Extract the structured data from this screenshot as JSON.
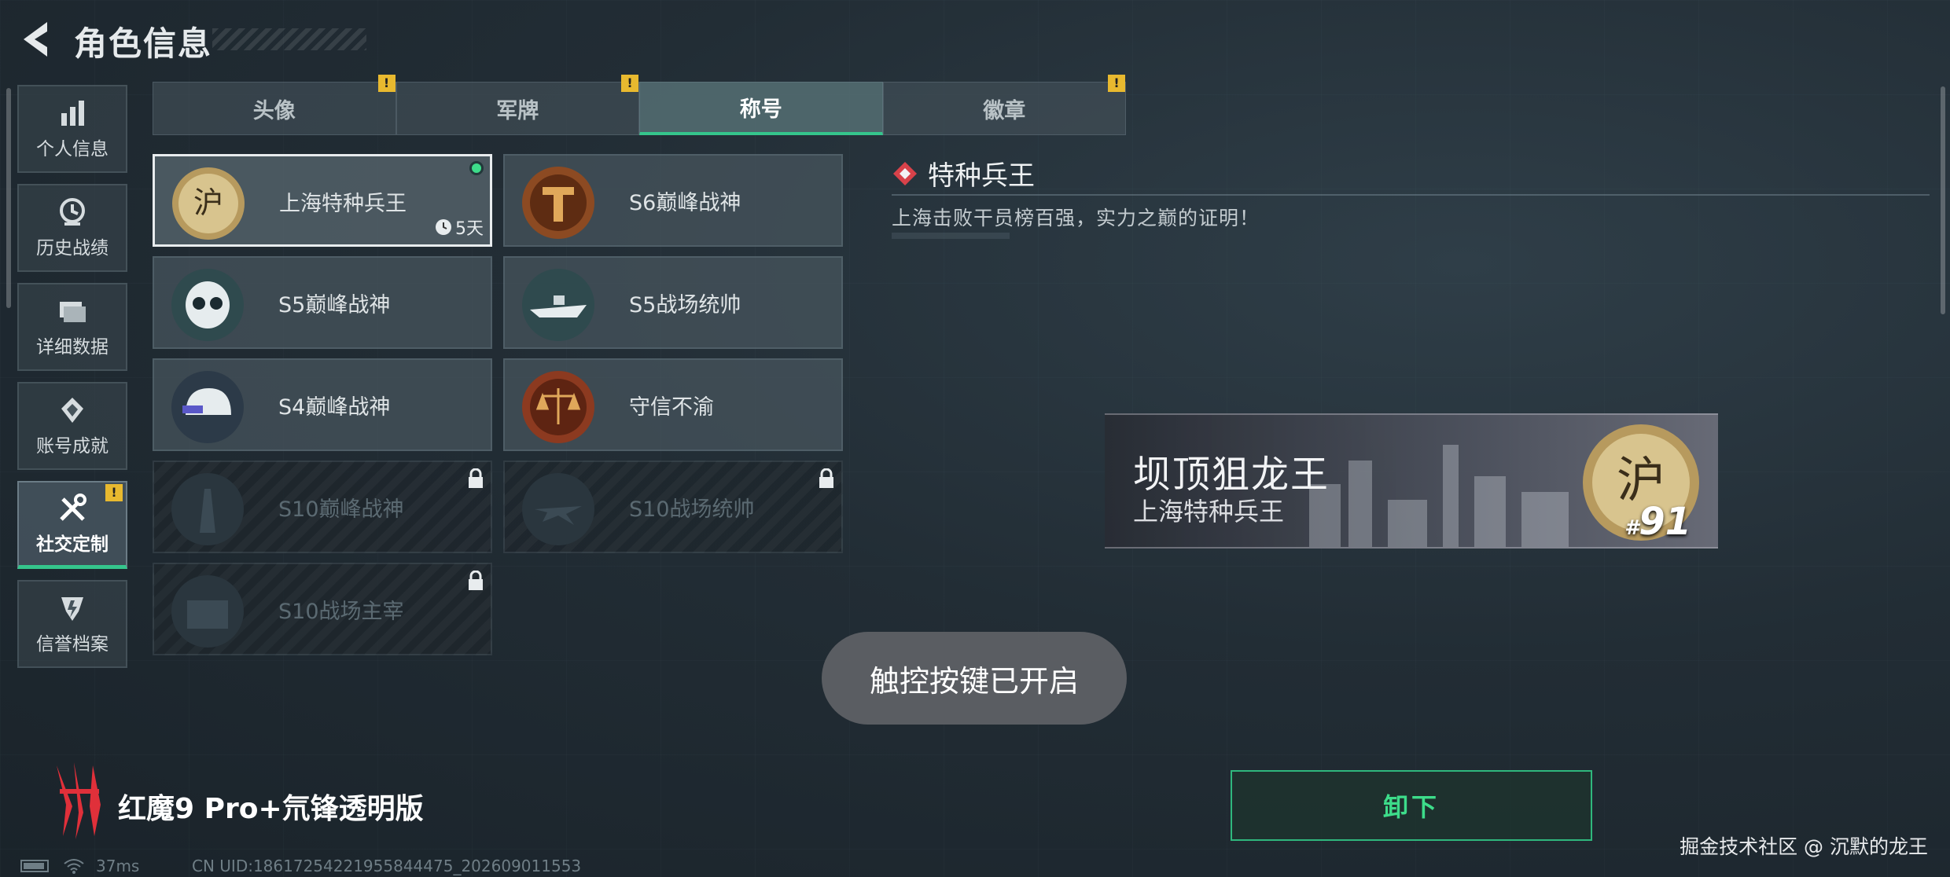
{
  "header": {
    "title": "角色信息"
  },
  "sidebar": {
    "items": [
      {
        "label": "个人信息",
        "icon": "bar-chart-icon",
        "active": false,
        "alert": false
      },
      {
        "label": "历史战绩",
        "icon": "clock-badge-icon",
        "active": false,
        "alert": false
      },
      {
        "label": "详细数据",
        "icon": "folder-icon",
        "active": false,
        "alert": false
      },
      {
        "label": "账号成就",
        "icon": "medal-icon",
        "active": false,
        "alert": false
      },
      {
        "label": "社交定制",
        "icon": "tools-icon",
        "active": true,
        "alert": true
      },
      {
        "label": "信誉档案",
        "icon": "shield-icon",
        "active": false,
        "alert": false
      }
    ],
    "alert_mark": "!"
  },
  "tabs": [
    {
      "label": "头像",
      "active": false,
      "alert": true
    },
    {
      "label": "军牌",
      "active": false,
      "alert": true
    },
    {
      "label": "称号",
      "active": true,
      "alert": false
    },
    {
      "label": "徽章",
      "active": false,
      "alert": true
    }
  ],
  "titles": [
    {
      "name": "上海特种兵王",
      "selected": true,
      "equipped": true,
      "timer": "5天",
      "locked": false,
      "emblem": "shanghai-gold-emblem"
    },
    {
      "name": "S6巅峰战神",
      "selected": false,
      "locked": false,
      "emblem": "bronze-t-emblem"
    },
    {
      "name": "S5巅峰战神",
      "selected": false,
      "locked": false,
      "emblem": "skull-diver-emblem"
    },
    {
      "name": "S5战场统帅",
      "selected": false,
      "locked": false,
      "emblem": "warship-emblem"
    },
    {
      "name": "S4巅峰战神",
      "selected": false,
      "locked": false,
      "emblem": "helmet-emblem"
    },
    {
      "name": "守信不渝",
      "selected": false,
      "locked": false,
      "emblem": "scales-emblem"
    },
    {
      "name": "S10巅峰战神",
      "selected": false,
      "locked": true,
      "emblem": "tower-emblem"
    },
    {
      "name": "S10战场统帅",
      "selected": false,
      "locked": true,
      "emblem": "jet-emblem"
    },
    {
      "name": "S10战场主宰",
      "selected": false,
      "locked": true,
      "emblem": "colosseum-emblem"
    }
  ],
  "detail": {
    "title": "特种兵王",
    "description": "上海击败干员榜百强，实力之巅的证明！"
  },
  "nameplate": {
    "player_name": "坝顶狙龙王",
    "title": "上海特种兵王",
    "rank_prefix": "#",
    "rank": "91"
  },
  "toast": "触控按键已开启",
  "unequip_label": "卸下",
  "footer": {
    "device": "红魔9 Pro+氘锋透明版",
    "ping": "37ms",
    "uid": "CN UID:18617254221955844475_202609011553",
    "watermark": "掘金技术社区 @ 沉默的龙王"
  },
  "colors": {
    "accent_green": "#35c58c",
    "alert_yellow": "#e8b92f",
    "device_red": "#e0303a"
  }
}
